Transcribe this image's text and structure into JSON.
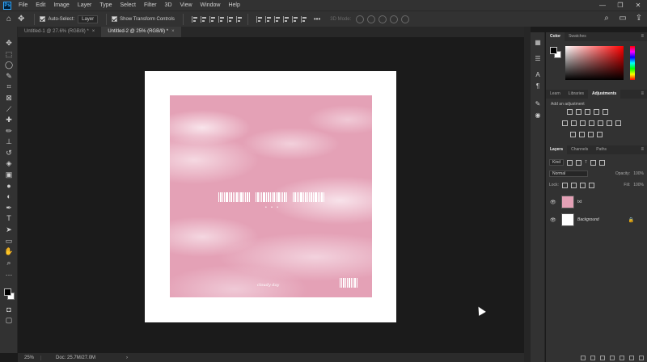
{
  "app": {
    "logo": "Ps"
  },
  "menu": [
    "File",
    "Edit",
    "Image",
    "Layer",
    "Type",
    "Select",
    "Filter",
    "3D",
    "View",
    "Window",
    "Help"
  ],
  "window_controls": {
    "minimize": "—",
    "restore": "❐",
    "close": "✕"
  },
  "options": {
    "auto_select_label": "Auto-Select:",
    "auto_select_value": "Layer",
    "transform_label": "Show Transform Controls",
    "mode_3d_label": "3D Mode:"
  },
  "tabs": [
    {
      "label": "Untitled-1 @ 27.6% (RGB/8) *",
      "close": "×"
    },
    {
      "label": "Untitled-2 @ 25% (RGB/8) *",
      "close": "×"
    }
  ],
  "status": {
    "zoom": "25%",
    "doc_size": "Doc: 25.7M/27.0M",
    "arrow": "›"
  },
  "panels": {
    "color_tabs": [
      "Color",
      "Swatches"
    ],
    "adjust_tabs": [
      "Learn",
      "Libraries",
      "Adjustments"
    ],
    "adjust_label": "Add an adjustment",
    "layers_tabs": [
      "Layers",
      "Channels",
      "Paths"
    ],
    "kind_label": "Kind",
    "blend_mode": "Normal",
    "opacity_label": "Opacity:",
    "opacity_value": "100%",
    "lock_label": "Lock:",
    "fill_label": "Fill:",
    "fill_value": "100%",
    "layers": [
      {
        "name": "txt",
        "visible": true,
        "thumb": "pink"
      },
      {
        "name": "Background",
        "visible": true,
        "thumb": "white",
        "locked": true
      }
    ]
  },
  "artwork": {
    "dots": "• • •",
    "signature": "cloudy day"
  },
  "colors": {
    "accent": "#31a8ff",
    "artwork_pink": "#e4a1b6"
  }
}
